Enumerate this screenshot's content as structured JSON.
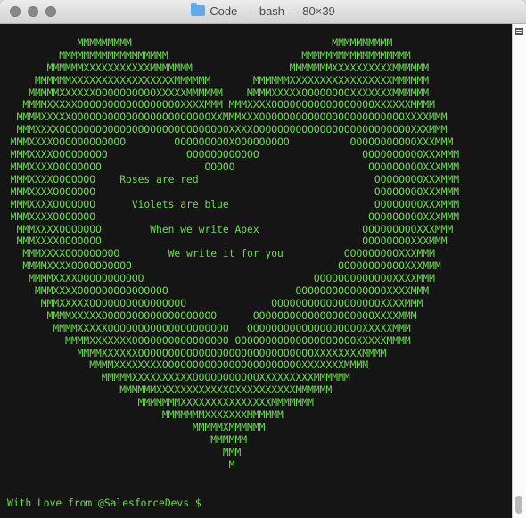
{
  "window": {
    "title": "Code — -bash — 80×39"
  },
  "terminal": {
    "art_lines": [
      "",
      "            MMMMMMMMM                                 MMMMMMMMMM",
      "         MMMMMMMMMMMMMMMMMM                      MMMMMMMMMMMMMMMMMM",
      "       MMMMMMXXXXXXXXXXXMMMMMMM                MMMMMMMXXXXXXXXXXMMMMMM",
      "     MMMMMMXXXXXXXXXXXXXXXXXMMMMMM       MMMMMMXXXXXXXXXXXXXXXXXMMMMMM",
      "    MMMMMXXXXXXOOOOOOOOOOXXXXXMMMMMM    MMMMXXXXXOOOOOOOOXXXXXXXMMMMMM",
      "   MMMMXXXXXOOOOOOOOOOOOOOOOOXXXXMMM MMMXXXXOOOOOOOOOOOOOOOOOXXXXXXMMMM",
      "  MMMMXXXXXOOOOOOOOOOOOOOOOOOOOOOOXXMMMXXXOOOOOOOOOOOOOOOOOOOOOOOOXXXXMMM",
      "  MMMXXXXOOOOOOOOOOOOOOOOOOOOOOOOOOOOXXXXOOOOOOOOOOOOOOOOOOOOOOOOOOXXXMMM",
      " MMMXXXXOOOOOOOOOOOO        OOOOOOOOOXOOOOOOOOO          OOOOOOOOOOOXXXMMM",
      " MMMXXXXOOOOOOOOO             OOOOOOOOOOOO                 OOOOOOOOOOXXXMMM",
      " MMMXXXXOOOOOOOO                 OOOOO                      OOOOOOOOOXXXMMM",
      " MMMXXXXOOOOOOO    Roses are red                             OOOOOOOOXXXMMM",
      " MMMXXXXOOOOOOO                                              OOOOOOOOXXXMMM",
      " MMMXXXXOOOOOOO      Violets are blue                        OOOOOOOOXXXMMM",
      " MMMXXXXOOOOOOO                                             OOOOOOOOOXXXMMM",
      "  MMMXXXXOOOOOOO        When we write Apex                 OOOOOOOOOXXXMMM",
      "  MMMXXXXOOOOOOO                                           OOOOOOOOXXXMMM",
      "   MMMXXXXOOOOOOOOO        We write it for you          OOOOOOOOOXXXMMM",
      "   MMMMXXXXOOOOOOOOOO                                  OOOOOOOOOOOXXXMMM",
      "    MMMMXXXXOOOOOOOOOOO                            OOOOOOOOOOOOOXXXXMMM",
      "     MMMXXXXOOOOOOOOOOOOOOO                     OOOOOOOOOOOOOOOXXXXMMM",
      "      MMMXXXXXOOOOOOOOOOOOOOOO              OOOOOOOOOOOOOOOOOOXXXXMMM",
      "       MMMMXXXXXOOOOOOOOOOOOOOOOOOO      OOOOOOOOOOOOOOOOOOOOXXXXMMM",
      "        MMMMXXXXXOOOOOOOOOOOOOOOOOOOO   OOOOOOOOOOOOOOOOOOOXXXXXMMM",
      "          MMMMXXXXXXXOOOOOOOOOOOOOOOO OOOOOOOOOOOOOOOOOOOOXXXXXMMMM",
      "            MMMMXXXXXXOOOOOOOOOOOOOOOOOOOOOOOOOOOOOXXXXXXXXMMMM",
      "              MMMMXXXXXXXXOOOOOOOOOOOOOOOOOOOOOOOXXXXXXXMMMM",
      "                MMMMMXXXXXXXXXXOOOOOOOOOOOXXXXXXXXXMMMMMM",
      "                   MMMMMMXXXXXXXXXXXXOXXXXXXXXXXMMMMMM",
      "                      MMMMMMMXXXXXXXXXXXXXXXMMMMMMM",
      "                          MMMMMMMXXXXXXXMMMMMM",
      "                               MMMMMXMMMMMM",
      "                                  MMMMMM",
      "                                    MMM",
      "                                     M"
    ],
    "prompt": "With Love from @SalesforceDevs $ "
  },
  "colors": {
    "terminal_bg": "#151515",
    "terminal_text": "#6edb55",
    "titlebar": "#e4e4e4"
  },
  "icons": [
    "folder-icon",
    "close-icon",
    "minimize-icon",
    "zoom-icon",
    "menu-icon"
  ]
}
